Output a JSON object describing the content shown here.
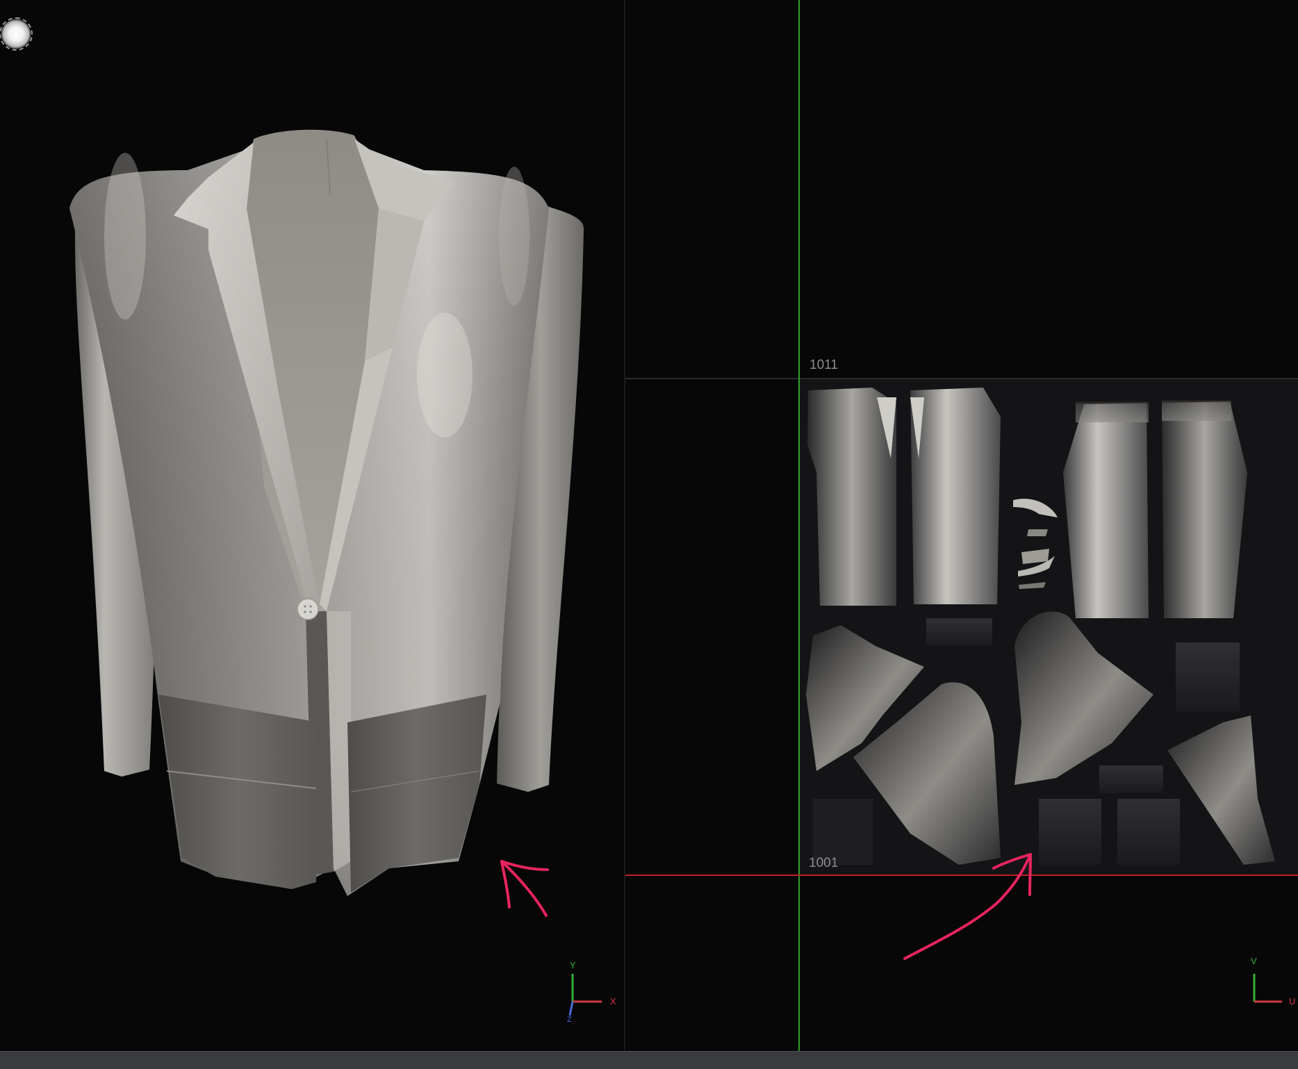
{
  "viewport_3d": {
    "light_handle": "light-sphere-icon",
    "axis_gizmo": {
      "y_label": "Y",
      "x_label": "X",
      "z_label": "Z"
    }
  },
  "viewport_uv": {
    "tile_upper": "1011",
    "tile_lower": "1001",
    "axis_gizmo": {
      "v_label": "V",
      "u_label": "U"
    }
  },
  "colors": {
    "annotation": "#e8245e",
    "v_axis_line": "#2fa12f",
    "u_axis_line": "#c0202a",
    "background": "#070708",
    "uv_tile_bg": "#141416"
  }
}
